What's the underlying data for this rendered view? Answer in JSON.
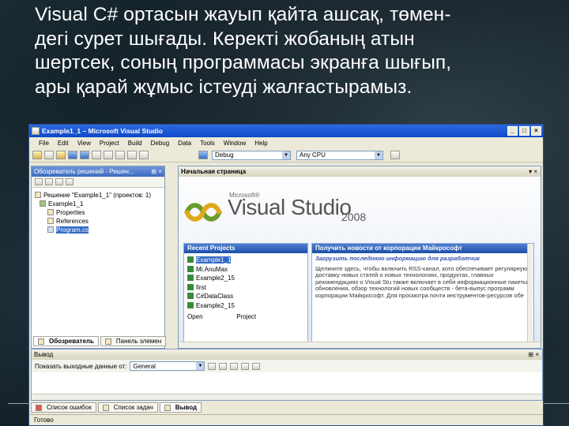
{
  "caption": [
    "Visual C# ортасын жауып қайта ашсақ, төмен-",
    "дегі сурет шығады. Керекті жобаның атын",
    "шертсек, соның программасы экранға шығып,",
    "ары қарай жұмыс істеуді жалғастырамыз."
  ],
  "window": {
    "title": "Example1_1 – Microsoft Visual Studio",
    "buttons": [
      "_",
      "□",
      "×"
    ],
    "menu": [
      "File",
      "Edit",
      "View",
      "Project",
      "Build",
      "Debug",
      "Data",
      "Tools",
      "Window",
      "Help"
    ],
    "toolbar": {
      "config": "Debug",
      "platform": "Any CPU"
    }
  },
  "solution_explorer": {
    "title": "Обозреватель решений - Решен...",
    "items": [
      "Решение \"Example1_1\" (проектов: 1)",
      "Example1_1",
      "Properties",
      "References",
      "Program.cs"
    ],
    "tabs": [
      "Обозреватель",
      "Панель элемен"
    ]
  },
  "start_page": {
    "tab": "Начальная страница",
    "logo": {
      "company": "Microsoft®",
      "product": "Visual Studio",
      "year": "2008"
    },
    "recent": {
      "title": "Recent Projects",
      "items": [
        "Example1_1",
        "Mi.AnuMax",
        "Example2_15",
        "first",
        "C#DataClass",
        "Example2_15"
      ],
      "open_label": "Open",
      "open_value": "Project"
    },
    "news": {
      "title": "Получить новости от корпорации Майкрософт",
      "lead": "Загрузить последнюю информацию для разработчик",
      "body": "Щелкните здесь, чтобы включить RSS-канал, кото обеспечивает регулярную доставку новых статей о новых технологиях, продуктах, главных рекомендациях о Visual Stu также включает в себя информационные пакеты обновления, обзор технологий новых сообществ - бета-выпус программ корпорации Майкрософт. Для просмотра почти инструментов-ресурсов обе"
    }
  },
  "output": {
    "title": "Вывод",
    "show_label": "Показать выходные данные от:",
    "source": "General",
    "tabs": [
      "Список ошибок",
      "Список задач",
      "Вывод"
    ]
  },
  "status": "Готово",
  "colors": {
    "titlebar": "#0f48c8",
    "accent": "#316ac5",
    "window": "#ece9d8"
  }
}
